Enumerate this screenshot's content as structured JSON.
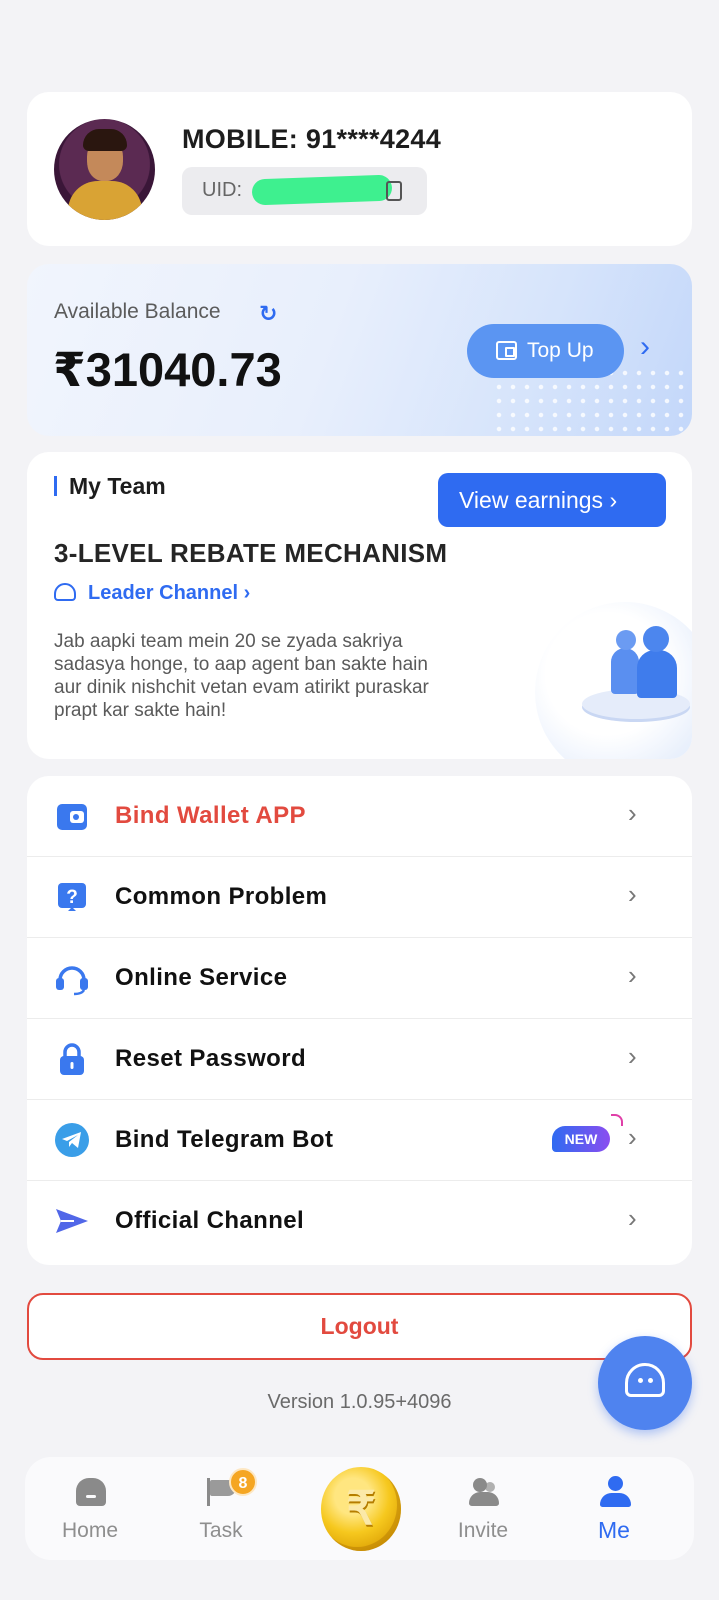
{
  "profile": {
    "mobile": "MOBILE: 91****4244",
    "uid_label": "UID: "
  },
  "balance": {
    "label": "Available Balance",
    "amount": "₹31040.73",
    "top_up_label": "Top Up"
  },
  "team": {
    "title": "My Team",
    "view_earnings_label": "View earnings ›",
    "mechanism": "3-LEVEL REBATE MECHANISM",
    "leader_channel": "Leader Channel ›",
    "description": "Jab aapki team mein 20 se zyada sakriya sadasya honge, to aap agent ban sakte hain aur dinik nishchit vetan evam atirikt puraskar prapt kar sakte hain!"
  },
  "menu": {
    "items": [
      {
        "label": "Bind Wallet APP",
        "icon": "wallet-icon"
      },
      {
        "label": "Common Problem",
        "icon": "question-icon"
      },
      {
        "label": "Online Service",
        "icon": "headset-icon"
      },
      {
        "label": "Reset Password",
        "icon": "lock-icon"
      },
      {
        "label": "Bind Telegram Bot",
        "icon": "telegram-icon",
        "badge": "NEW"
      },
      {
        "label": "Official Channel",
        "icon": "send-icon"
      }
    ]
  },
  "logout_label": "Logout",
  "version": "Version 1.0.95+4096",
  "nav": {
    "items": [
      {
        "label": "Home",
        "icon": "home-icon"
      },
      {
        "label": "Task",
        "icon": "flag-icon",
        "badge": "8"
      },
      {
        "label": "Invite",
        "icon": "users-icon"
      },
      {
        "label": "Me",
        "icon": "user-icon",
        "active": true
      }
    ],
    "center_icon": "rupee-coin-icon"
  },
  "colors": {
    "accent": "#2f6bf1",
    "danger": "#e24a3f",
    "badge": "#f5a623"
  }
}
